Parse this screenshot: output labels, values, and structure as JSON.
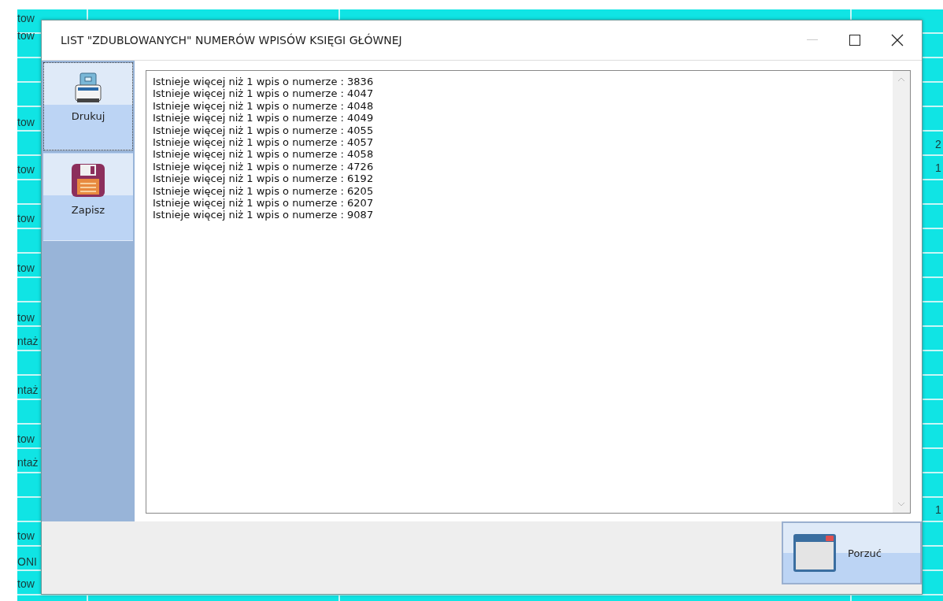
{
  "background": {
    "left_fragments": [
      "tow",
      "tow",
      "tow",
      "tow",
      "tow",
      "tow",
      "tow",
      "ntaż",
      "ntaż",
      "tow",
      "ntaż",
      "tow",
      "ONI",
      "tow"
    ],
    "right_fragments": [
      "2",
      "1",
      "1"
    ]
  },
  "window": {
    "title": "LIST \"ZDUBLOWANYCH\" NUMERÓW WPISÓW KSIĘGI GŁÓWNEJ"
  },
  "sidebar": {
    "items": [
      {
        "label": "Drukuj",
        "kind": "print",
        "selected": true
      },
      {
        "label": "Zapisz",
        "kind": "save",
        "selected": false
      }
    ]
  },
  "text_area": {
    "lines": [
      "Istnieje więcej niż 1 wpis o numerze : 3836",
      "Istnieje więcej niż 1 wpis o numerze : 4047",
      "Istnieje więcej niż 1 wpis o numerze : 4048",
      "Istnieje więcej niż 1 wpis o numerze : 4049",
      "Istnieje więcej niż 1 wpis o numerze : 4055",
      "Istnieje więcej niż 1 wpis o numerze : 4057",
      "Istnieje więcej niż 1 wpis o numerze : 4058",
      "Istnieje więcej niż 1 wpis o numerze : 4726",
      "Istnieje więcej niż 1 wpis o numerze : 6192",
      "Istnieje więcej niż 1 wpis o numerze : 6205",
      "Istnieje więcej niż 1 wpis o numerze : 6207",
      "Istnieje więcej niż 1 wpis o numerze : 9087"
    ]
  },
  "footer": {
    "buttons": [
      {
        "label": "Porzuć"
      }
    ]
  }
}
